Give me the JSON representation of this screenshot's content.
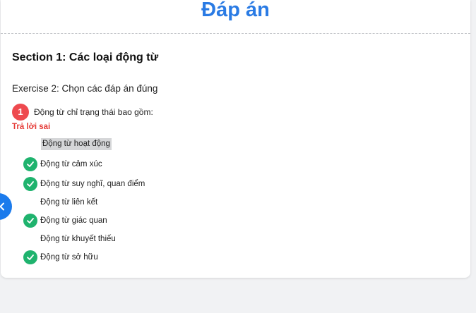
{
  "header": {
    "title": "Đáp án"
  },
  "section": {
    "title": "Section 1: Các loại động từ"
  },
  "exercise": {
    "title": "Exercise 2: Chọn các đáp án đúng"
  },
  "question": {
    "number": "1",
    "text": "Động từ chỉ trạng thái bao gồm:",
    "result": "Trả lời sai",
    "options": [
      {
        "label": "Động từ hoạt động",
        "selected": true,
        "correct": false
      },
      {
        "label": "Động từ cảm xúc",
        "selected": false,
        "correct": true
      },
      {
        "label": "Động từ suy nghĩ, quan điểm",
        "selected": false,
        "correct": true
      },
      {
        "label": "Động từ liên kết",
        "selected": false,
        "correct": false
      },
      {
        "label": "Động từ giác quan",
        "selected": false,
        "correct": true
      },
      {
        "label": "Động từ khuyết thiếu",
        "selected": false,
        "correct": false
      },
      {
        "label": "Động từ sở hữu",
        "selected": false,
        "correct": true
      }
    ]
  },
  "icons": {
    "correct": "check-circle-icon",
    "back": "chevron-left-icon"
  },
  "colors": {
    "accent": "#2a7be4",
    "wrong": "#e53935",
    "correct": "#1fb36e",
    "badge": "#ee4a4f",
    "selected_bg": "#d5d6d8"
  }
}
